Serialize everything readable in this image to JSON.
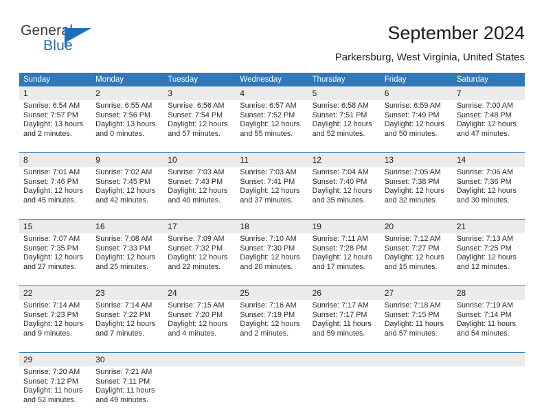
{
  "brand": {
    "name_top": "General",
    "name_bottom": "Blue",
    "accent_color": "#1c6fba"
  },
  "header": {
    "title": "September 2024",
    "location": "Parkersburg, West Virginia, United States"
  },
  "theme": {
    "header_blue": "#3178b9",
    "daynum_gray": "#ebebeb",
    "text_dark": "#1a1a1a"
  },
  "weekdays": [
    "Sunday",
    "Monday",
    "Tuesday",
    "Wednesday",
    "Thursday",
    "Friday",
    "Saturday"
  ],
  "weeks": [
    {
      "days": [
        {
          "num": "1",
          "sunrise": "Sunrise: 6:54 AM",
          "sunset": "Sunset: 7:57 PM",
          "daylight1": "Daylight: 13 hours",
          "daylight2": "and 2 minutes."
        },
        {
          "num": "2",
          "sunrise": "Sunrise: 6:55 AM",
          "sunset": "Sunset: 7:56 PM",
          "daylight1": "Daylight: 13 hours",
          "daylight2": "and 0 minutes."
        },
        {
          "num": "3",
          "sunrise": "Sunrise: 6:56 AM",
          "sunset": "Sunset: 7:54 PM",
          "daylight1": "Daylight: 12 hours",
          "daylight2": "and 57 minutes."
        },
        {
          "num": "4",
          "sunrise": "Sunrise: 6:57 AM",
          "sunset": "Sunset: 7:52 PM",
          "daylight1": "Daylight: 12 hours",
          "daylight2": "and 55 minutes."
        },
        {
          "num": "5",
          "sunrise": "Sunrise: 6:58 AM",
          "sunset": "Sunset: 7:51 PM",
          "daylight1": "Daylight: 12 hours",
          "daylight2": "and 52 minutes."
        },
        {
          "num": "6",
          "sunrise": "Sunrise: 6:59 AM",
          "sunset": "Sunset: 7:49 PM",
          "daylight1": "Daylight: 12 hours",
          "daylight2": "and 50 minutes."
        },
        {
          "num": "7",
          "sunrise": "Sunrise: 7:00 AM",
          "sunset": "Sunset: 7:48 PM",
          "daylight1": "Daylight: 12 hours",
          "daylight2": "and 47 minutes."
        }
      ]
    },
    {
      "days": [
        {
          "num": "8",
          "sunrise": "Sunrise: 7:01 AM",
          "sunset": "Sunset: 7:46 PM",
          "daylight1": "Daylight: 12 hours",
          "daylight2": "and 45 minutes."
        },
        {
          "num": "9",
          "sunrise": "Sunrise: 7:02 AM",
          "sunset": "Sunset: 7:45 PM",
          "daylight1": "Daylight: 12 hours",
          "daylight2": "and 42 minutes."
        },
        {
          "num": "10",
          "sunrise": "Sunrise: 7:03 AM",
          "sunset": "Sunset: 7:43 PM",
          "daylight1": "Daylight: 12 hours",
          "daylight2": "and 40 minutes."
        },
        {
          "num": "11",
          "sunrise": "Sunrise: 7:03 AM",
          "sunset": "Sunset: 7:41 PM",
          "daylight1": "Daylight: 12 hours",
          "daylight2": "and 37 minutes."
        },
        {
          "num": "12",
          "sunrise": "Sunrise: 7:04 AM",
          "sunset": "Sunset: 7:40 PM",
          "daylight1": "Daylight: 12 hours",
          "daylight2": "and 35 minutes."
        },
        {
          "num": "13",
          "sunrise": "Sunrise: 7:05 AM",
          "sunset": "Sunset: 7:38 PM",
          "daylight1": "Daylight: 12 hours",
          "daylight2": "and 32 minutes."
        },
        {
          "num": "14",
          "sunrise": "Sunrise: 7:06 AM",
          "sunset": "Sunset: 7:36 PM",
          "daylight1": "Daylight: 12 hours",
          "daylight2": "and 30 minutes."
        }
      ]
    },
    {
      "days": [
        {
          "num": "15",
          "sunrise": "Sunrise: 7:07 AM",
          "sunset": "Sunset: 7:35 PM",
          "daylight1": "Daylight: 12 hours",
          "daylight2": "and 27 minutes."
        },
        {
          "num": "16",
          "sunrise": "Sunrise: 7:08 AM",
          "sunset": "Sunset: 7:33 PM",
          "daylight1": "Daylight: 12 hours",
          "daylight2": "and 25 minutes."
        },
        {
          "num": "17",
          "sunrise": "Sunrise: 7:09 AM",
          "sunset": "Sunset: 7:32 PM",
          "daylight1": "Daylight: 12 hours",
          "daylight2": "and 22 minutes."
        },
        {
          "num": "18",
          "sunrise": "Sunrise: 7:10 AM",
          "sunset": "Sunset: 7:30 PM",
          "daylight1": "Daylight: 12 hours",
          "daylight2": "and 20 minutes."
        },
        {
          "num": "19",
          "sunrise": "Sunrise: 7:11 AM",
          "sunset": "Sunset: 7:28 PM",
          "daylight1": "Daylight: 12 hours",
          "daylight2": "and 17 minutes."
        },
        {
          "num": "20",
          "sunrise": "Sunrise: 7:12 AM",
          "sunset": "Sunset: 7:27 PM",
          "daylight1": "Daylight: 12 hours",
          "daylight2": "and 15 minutes."
        },
        {
          "num": "21",
          "sunrise": "Sunrise: 7:13 AM",
          "sunset": "Sunset: 7:25 PM",
          "daylight1": "Daylight: 12 hours",
          "daylight2": "and 12 minutes."
        }
      ]
    },
    {
      "days": [
        {
          "num": "22",
          "sunrise": "Sunrise: 7:14 AM",
          "sunset": "Sunset: 7:23 PM",
          "daylight1": "Daylight: 12 hours",
          "daylight2": "and 9 minutes."
        },
        {
          "num": "23",
          "sunrise": "Sunrise: 7:14 AM",
          "sunset": "Sunset: 7:22 PM",
          "daylight1": "Daylight: 12 hours",
          "daylight2": "and 7 minutes."
        },
        {
          "num": "24",
          "sunrise": "Sunrise: 7:15 AM",
          "sunset": "Sunset: 7:20 PM",
          "daylight1": "Daylight: 12 hours",
          "daylight2": "and 4 minutes."
        },
        {
          "num": "25",
          "sunrise": "Sunrise: 7:16 AM",
          "sunset": "Sunset: 7:19 PM",
          "daylight1": "Daylight: 12 hours",
          "daylight2": "and 2 minutes."
        },
        {
          "num": "26",
          "sunrise": "Sunrise: 7:17 AM",
          "sunset": "Sunset: 7:17 PM",
          "daylight1": "Daylight: 11 hours",
          "daylight2": "and 59 minutes."
        },
        {
          "num": "27",
          "sunrise": "Sunrise: 7:18 AM",
          "sunset": "Sunset: 7:15 PM",
          "daylight1": "Daylight: 11 hours",
          "daylight2": "and 57 minutes."
        },
        {
          "num": "28",
          "sunrise": "Sunrise: 7:19 AM",
          "sunset": "Sunset: 7:14 PM",
          "daylight1": "Daylight: 11 hours",
          "daylight2": "and 54 minutes."
        }
      ]
    },
    {
      "days": [
        {
          "num": "29",
          "sunrise": "Sunrise: 7:20 AM",
          "sunset": "Sunset: 7:12 PM",
          "daylight1": "Daylight: 11 hours",
          "daylight2": "and 52 minutes."
        },
        {
          "num": "30",
          "sunrise": "Sunrise: 7:21 AM",
          "sunset": "Sunset: 7:11 PM",
          "daylight1": "Daylight: 11 hours",
          "daylight2": "and 49 minutes."
        },
        {
          "num": "",
          "sunrise": "",
          "sunset": "",
          "daylight1": "",
          "daylight2": ""
        },
        {
          "num": "",
          "sunrise": "",
          "sunset": "",
          "daylight1": "",
          "daylight2": ""
        },
        {
          "num": "",
          "sunrise": "",
          "sunset": "",
          "daylight1": "",
          "daylight2": ""
        },
        {
          "num": "",
          "sunrise": "",
          "sunset": "",
          "daylight1": "",
          "daylight2": ""
        },
        {
          "num": "",
          "sunrise": "",
          "sunset": "",
          "daylight1": "",
          "daylight2": ""
        }
      ]
    }
  ]
}
